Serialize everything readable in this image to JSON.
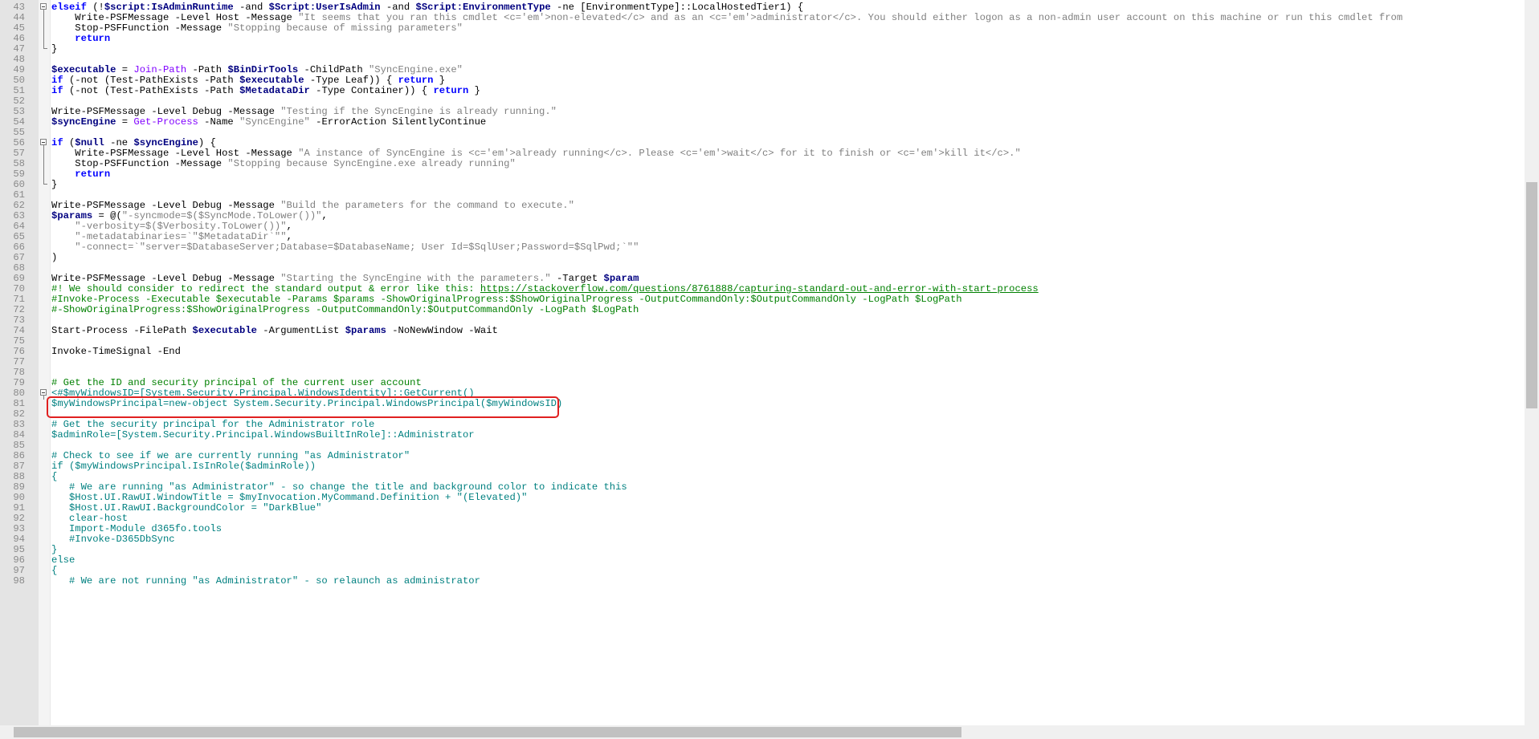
{
  "editor": {
    "lines": [
      {
        "n": "43",
        "fold": "none",
        "text": "elseif (!$script:IsAdminRuntime -and $Script:UserIsAdmin -and $Script:EnvironmentType -ne [EnvironmentType]::LocalHostedTier1) {"
      },
      {
        "n": "44",
        "fold": "line",
        "text": "    Write-PSFMessage -Level Host -Message \"It seems that you ran this cmdlet <c='em'>non-elevated</c> and as an <c='em'>administrator</c>. You should either logon as a non-admin user account on this machine or run this cmdlet from"
      },
      {
        "n": "45",
        "fold": "line",
        "text": "    Stop-PSFFunction -Message \"Stopping because of missing parameters\""
      },
      {
        "n": "46",
        "fold": "line",
        "text": "    return"
      },
      {
        "n": "47",
        "fold": "end",
        "text": "}"
      },
      {
        "n": "48",
        "fold": "none",
        "text": ""
      },
      {
        "n": "49",
        "fold": "none",
        "text": "$executable = Join-Path -Path $BinDirTools -ChildPath \"SyncEngine.exe\""
      },
      {
        "n": "50",
        "fold": "none",
        "text": "if (-not (Test-PathExists -Path $executable -Type Leaf)) { return }"
      },
      {
        "n": "51",
        "fold": "none",
        "text": "if (-not (Test-PathExists -Path $MetadataDir -Type Container)) { return }"
      },
      {
        "n": "52",
        "fold": "none",
        "text": ""
      },
      {
        "n": "53",
        "fold": "none",
        "text": "Write-PSFMessage -Level Debug -Message \"Testing if the SyncEngine is already running.\""
      },
      {
        "n": "54",
        "fold": "none",
        "text": "$syncEngine = Get-Process -Name \"SyncEngine\" -ErrorAction SilentlyContinue"
      },
      {
        "n": "55",
        "fold": "none",
        "text": ""
      },
      {
        "n": "56",
        "fold": "start",
        "text": "if ($null -ne $syncEngine) {"
      },
      {
        "n": "57",
        "fold": "line",
        "text": "    Write-PSFMessage -Level Host -Message \"A instance of SyncEngine is <c='em'>already running</c>. Please <c='em'>wait</c> for it to finish or <c='em'>kill it</c>.\""
      },
      {
        "n": "58",
        "fold": "line",
        "text": "    Stop-PSFFunction -Message \"Stopping because SyncEngine.exe already running\""
      },
      {
        "n": "59",
        "fold": "line",
        "text": "    return"
      },
      {
        "n": "60",
        "fold": "end",
        "text": "}"
      },
      {
        "n": "61",
        "fold": "none",
        "text": ""
      },
      {
        "n": "62",
        "fold": "none",
        "text": "Write-PSFMessage -Level Debug -Message \"Build the parameters for the command to execute.\""
      },
      {
        "n": "63",
        "fold": "none",
        "text": "$params = @(\"-syncmode=$($SyncMode.ToLower())\","
      },
      {
        "n": "64",
        "fold": "none",
        "text": "    \"-verbosity=$($Verbosity.ToLower())\","
      },
      {
        "n": "65",
        "fold": "none",
        "text": "    \"-metadatabinaries=`\"$MetadataDir`\"\","
      },
      {
        "n": "66",
        "fold": "none",
        "text": "    \"-connect=`\"server=$DatabaseServer;Database=$DatabaseName; User Id=$SqlUser;Password=$SqlPwd;`\"\""
      },
      {
        "n": "67",
        "fold": "none",
        "text": ")"
      },
      {
        "n": "68",
        "fold": "none",
        "text": ""
      },
      {
        "n": "69",
        "fold": "none",
        "text": "Write-PSFMessage -Level Debug -Message \"Starting the SyncEngine with the parameters.\" -Target $param"
      },
      {
        "n": "70",
        "fold": "none",
        "text": "#! We should consider to redirect the standard output & error like this: https://stackoverflow.com/questions/8761888/capturing-standard-out-and-error-with-start-process"
      },
      {
        "n": "71",
        "fold": "none",
        "text": "#Invoke-Process -Executable $executable -Params $params -ShowOriginalProgress:$ShowOriginalProgress -OutputCommandOnly:$OutputCommandOnly -LogPath $LogPath"
      },
      {
        "n": "72",
        "fold": "none",
        "text": "#-ShowOriginalProgress:$ShowOriginalProgress -OutputCommandOnly:$OutputCommandOnly -LogPath $LogPath"
      },
      {
        "n": "73",
        "fold": "none",
        "text": ""
      },
      {
        "n": "74",
        "fold": "none",
        "text": "Start-Process -FilePath $executable -ArgumentList $params -NoNewWindow -Wait"
      },
      {
        "n": "75",
        "fold": "none",
        "text": ""
      },
      {
        "n": "76",
        "fold": "none",
        "text": "Invoke-TimeSignal -End"
      },
      {
        "n": "77",
        "fold": "none",
        "text": ""
      },
      {
        "n": "78",
        "fold": "none",
        "text": ""
      },
      {
        "n": "79",
        "fold": "none",
        "text": "# Get the ID and security principal of the current user account"
      },
      {
        "n": "80",
        "fold": "start",
        "text": "<#$myWindowsID=[System.Security.Principal.WindowsIdentity]::GetCurrent()"
      },
      {
        "n": "81",
        "fold": "none",
        "text": "$myWindowsPrincipal=new-object System.Security.Principal.WindowsPrincipal($myWindowsID)"
      },
      {
        "n": "82",
        "fold": "none",
        "text": ""
      },
      {
        "n": "83",
        "fold": "none",
        "text": "# Get the security principal for the Administrator role"
      },
      {
        "n": "84",
        "fold": "none",
        "text": "$adminRole=[System.Security.Principal.WindowsBuiltInRole]::Administrator"
      },
      {
        "n": "85",
        "fold": "none",
        "text": ""
      },
      {
        "n": "86",
        "fold": "none",
        "text": "# Check to see if we are currently running \"as Administrator\""
      },
      {
        "n": "87",
        "fold": "none",
        "text": "if ($myWindowsPrincipal.IsInRole($adminRole))"
      },
      {
        "n": "88",
        "fold": "none",
        "text": "{"
      },
      {
        "n": "89",
        "fold": "none",
        "text": "   # We are running \"as Administrator\" - so change the title and background color to indicate this"
      },
      {
        "n": "90",
        "fold": "none",
        "text": "   $Host.UI.RawUI.WindowTitle = $myInvocation.MyCommand.Definition + \"(Elevated)\""
      },
      {
        "n": "91",
        "fold": "none",
        "text": "   $Host.UI.RawUI.BackgroundColor = \"DarkBlue\""
      },
      {
        "n": "92",
        "fold": "none",
        "text": "   clear-host"
      },
      {
        "n": "93",
        "fold": "none",
        "text": "   Import-Module d365fo.tools"
      },
      {
        "n": "94",
        "fold": "none",
        "text": "   #Invoke-D365DbSync"
      },
      {
        "n": "95",
        "fold": "none",
        "text": "}"
      },
      {
        "n": "96",
        "fold": "none",
        "text": "else"
      },
      {
        "n": "97",
        "fold": "none",
        "text": "{"
      },
      {
        "n": "98",
        "fold": "none",
        "text": "   # We are not running \"as Administrator\" - so relaunch as administrator"
      }
    ],
    "colors": {
      "keyword": "#0000ff",
      "variable": "#000080",
      "string": "#808080",
      "comment": "#008000",
      "block_comment": "#008080",
      "highlight_box": "#e02020"
    }
  }
}
